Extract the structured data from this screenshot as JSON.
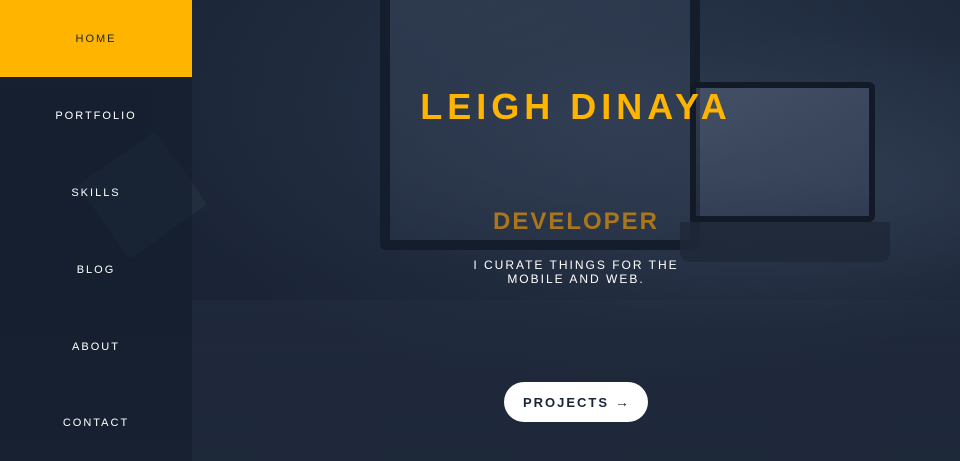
{
  "nav": {
    "items": [
      {
        "label": "HOME",
        "active": true
      },
      {
        "label": "PORTFOLIO",
        "active": false
      },
      {
        "label": "SKILLS",
        "active": false
      },
      {
        "label": "BLOG",
        "active": false
      },
      {
        "label": "ABOUT",
        "active": false
      },
      {
        "label": "CONTACT",
        "active": false
      }
    ]
  },
  "hero": {
    "name": "LEIGH DINAYA",
    "role": "DEVELOPER",
    "tagline": "I CURATE THINGS FOR THE MOBILE AND WEB.",
    "cta_label": "PROJECTS",
    "cta_icon": "arrow-right-icon"
  },
  "colors": {
    "accent": "#ffb400",
    "role_text": "#a9761c",
    "background": "#1a2537",
    "button_bg": "#ffffff"
  }
}
